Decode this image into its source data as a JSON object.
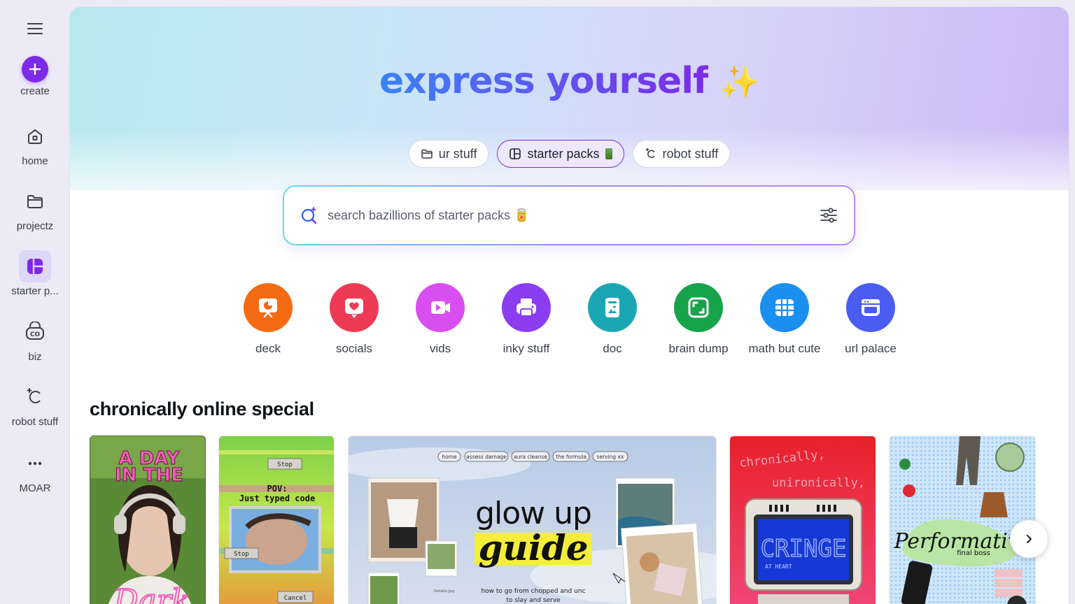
{
  "sidebar": {
    "menu_icon": "hamburger-icon",
    "items": [
      {
        "label": "create",
        "icon": "plus-icon"
      },
      {
        "label": "home",
        "icon": "home-icon"
      },
      {
        "label": "projectz",
        "icon": "folder-icon"
      },
      {
        "label": "starter p...",
        "icon": "template-icon"
      },
      {
        "label": "biz",
        "icon": "brand-icon"
      },
      {
        "label": "robot stuff",
        "icon": "magic-icon"
      },
      {
        "label": "MOAR",
        "icon": "more-icon"
      }
    ]
  },
  "hero": {
    "title": "express yourself",
    "sparkle": "✨"
  },
  "tabs": [
    {
      "label": "ur stuff",
      "icon": "folder-icon",
      "active": false
    },
    {
      "label": "starter packs",
      "icon": "template-icon",
      "active": true
    },
    {
      "label": "robot stuff",
      "icon": "magic-icon",
      "active": false
    }
  ],
  "search": {
    "placeholder": "search bazillions of starter packs 🥫"
  },
  "quick_actions": [
    {
      "label": "deck",
      "color": "#f56b14"
    },
    {
      "label": "socials",
      "color": "#ef3a56"
    },
    {
      "label": "vids",
      "color": "#d94ef0"
    },
    {
      "label": "inky stuff",
      "color": "#8b3df0"
    },
    {
      "label": "doc",
      "color": "#1ba6b4"
    },
    {
      "label": "brain dump",
      "color": "#16a34a"
    },
    {
      "label": "math but cute",
      "color": "#1b8ff0"
    },
    {
      "label": "url palace",
      "color": "#4b5cf0"
    }
  ],
  "section": {
    "title": "chronically online special"
  },
  "cards": {
    "c1": {
      "line1": "A DAY",
      "line2": "IN THE",
      "script": "Dark"
    },
    "c2": {
      "stop1": "Stop",
      "pov": "POV:",
      "pov2": "Just typed code",
      "stop2": "Stop",
      "cancel": "Cancel"
    },
    "c3": {
      "nav": [
        "home",
        "assess damage",
        "aura cleanse",
        "the formula",
        "serving xx"
      ],
      "title1": "glow up",
      "title2": "guide",
      "caption1": "how to go from chopped and unc",
      "caption2": "to slay and serve",
      "file1": "Details.jpg"
    },
    "c4": {
      "line1": "chronically,",
      "line2": "unironically,",
      "screen": "CRINGE",
      "sub": "AT HEART"
    },
    "c5": {
      "script": "Performative",
      "sub": "final boss"
    }
  }
}
